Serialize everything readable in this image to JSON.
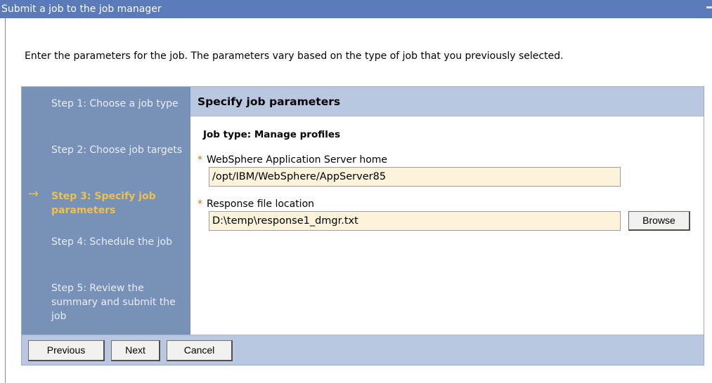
{
  "window": {
    "title": "Submit a job to the job manager"
  },
  "intro_text": "Enter the parameters for the job. The parameters vary based on the type of job that you previously selected.",
  "steps": [
    {
      "label": "Step 1: Choose a job type",
      "current": false
    },
    {
      "label": "Step 2: Choose job targets",
      "current": false
    },
    {
      "label": "Step 3: Specify job parameters",
      "current": true
    },
    {
      "label": "Step 4: Schedule the job",
      "current": false
    },
    {
      "label": "Step 5: Review the summary and submit the job",
      "current": false
    }
  ],
  "current_step_icon": "arrow-right-icon",
  "panel": {
    "title": "Specify job parameters",
    "job_type_label": "Job type: Manage profiles",
    "fields": [
      {
        "label": "WebSphere Application Server home",
        "required": true,
        "value": "/opt/IBM/WebSphere/AppServer85"
      },
      {
        "label": "Response file location",
        "required": true,
        "value": "D:\\temp\\response1_dmgr.txt"
      }
    ],
    "browse_label": "Browse"
  },
  "footer": {
    "previous_label": "Previous",
    "next_label": "Next",
    "cancel_label": "Cancel"
  },
  "required_marker": "*",
  "colors": {
    "title_bar": "#5a7ab9",
    "steps_bg": "#7791b8",
    "current_step": "#f0c14a",
    "header_bg": "#b9c8e0",
    "input_bg": "#fdf3da"
  }
}
